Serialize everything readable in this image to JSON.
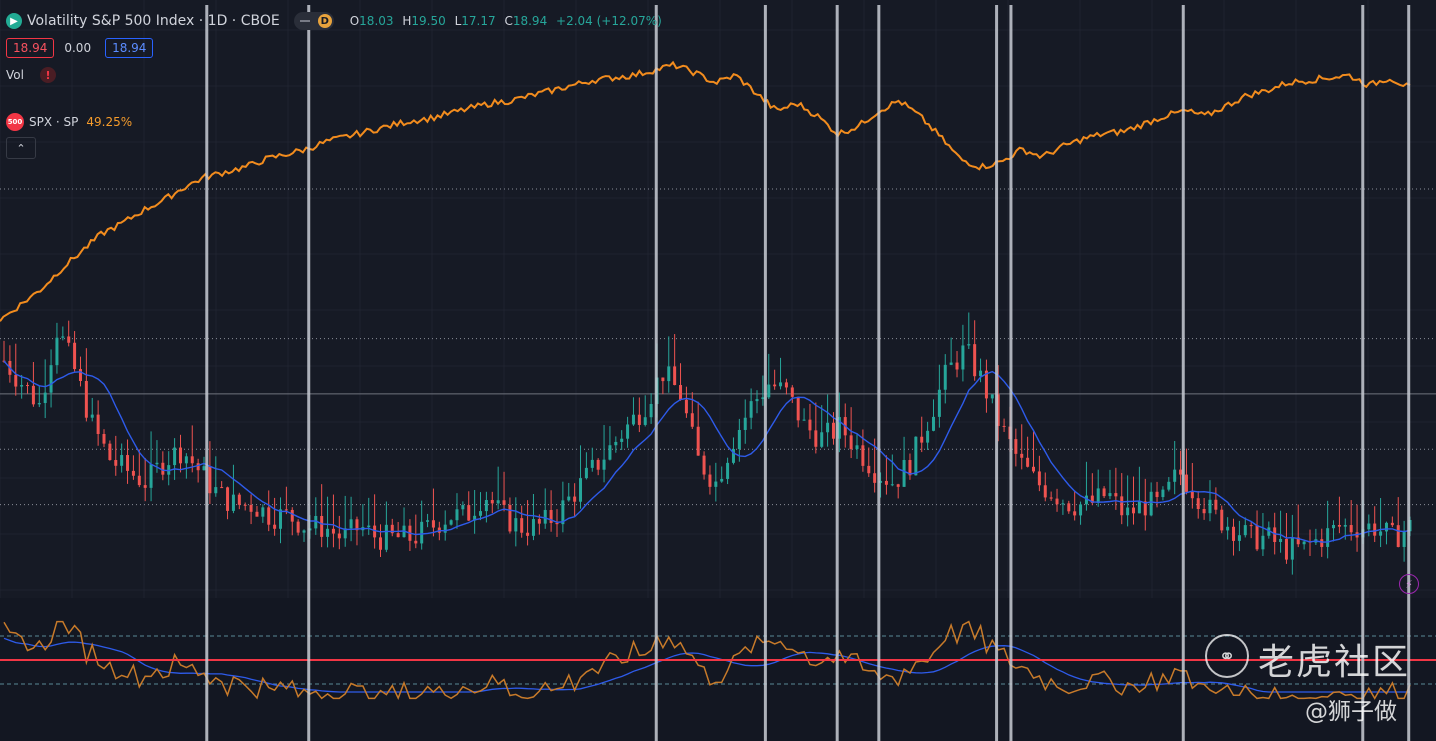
{
  "header": {
    "title": "Volatility S&P 500 Index · 1D · CBOE",
    "interval_badge": "D",
    "ohlc": [
      {
        "key": "O",
        "value": "18.03"
      },
      {
        "key": "H",
        "value": "19.50"
      },
      {
        "key": "L",
        "value": "17.17"
      },
      {
        "key": "C",
        "value": "18.94"
      }
    ],
    "change": "+2.04 (+12.07%)",
    "bid": "18.94",
    "spread": "0.00",
    "ask": "18.94",
    "vol_label": "Vol",
    "vol_warning": "!",
    "compare_label": "SPX · SP",
    "compare_icon_text": "500",
    "compare_pct": "49.25%"
  },
  "watermark": {
    "brand": "老虎社区",
    "author": "@狮子做"
  },
  "icons": [
    "arrow-right-icon",
    "warning-icon",
    "chevron-up-icon",
    "lightning-icon",
    "tiger-logo-icon"
  ],
  "colors": {
    "background": "#161a25",
    "spx_line": "#f28c1e",
    "ma_line": "#2e5bea",
    "up_candle": "#26a69a",
    "down_candle": "#ef5350",
    "osc_line": "#c77a2a",
    "osc_ref_line": "#f23645",
    "marker_line": "#c8ccd4"
  },
  "chart_data": {
    "type": "line",
    "note_series": [
      "SPX",
      "VIX",
      "VIX MA",
      "Oscillator"
    ],
    "vix_dashed_levels": [
      30,
      20,
      15
    ],
    "vix_solid_level": 25,
    "oscillator_reference_level": 0.5,
    "oscillator_band_levels": [
      0.8,
      0.2
    ],
    "marker_positions_fraction": [
      0.144,
      0.215,
      0.457,
      0.533,
      0.583,
      0.612,
      0.694,
      0.704,
      0.824,
      0.949,
      0.981
    ],
    "spx_normalized": [
      0.0,
      0.06,
      0.12,
      0.2,
      0.27,
      0.34,
      0.38,
      0.43,
      0.47,
      0.52,
      0.56,
      0.58,
      0.6,
      0.63,
      0.65,
      0.67,
      0.7,
      0.72,
      0.74,
      0.76,
      0.78,
      0.79,
      0.81,
      0.83,
      0.85,
      0.86,
      0.88,
      0.9,
      0.92,
      0.94,
      0.95,
      0.96,
      0.98,
      1.0,
      0.97,
      0.93,
      0.96,
      0.89,
      0.82,
      0.85,
      0.8,
      0.73,
      0.76,
      0.82,
      0.86,
      0.8,
      0.72,
      0.63,
      0.6,
      0.62,
      0.67,
      0.64,
      0.68,
      0.71,
      0.73,
      0.74,
      0.77,
      0.8,
      0.82,
      0.8,
      0.84,
      0.88,
      0.9,
      0.93,
      0.94,
      0.95,
      0.96,
      0.92,
      0.95,
      0.91
    ],
    "vix_close": [
      28,
      26,
      24,
      31,
      27,
      22,
      19,
      18,
      17,
      19,
      20,
      18,
      16,
      15,
      15,
      14,
      14,
      13,
      13,
      12,
      13,
      12,
      12,
      12,
      13,
      14,
      14,
      16,
      14,
      13,
      13,
      14,
      16,
      18,
      20,
      22,
      24,
      27,
      25,
      19,
      17,
      21,
      24,
      26,
      25,
      22,
      21,
      22,
      20,
      18,
      17,
      19,
      23,
      27,
      29,
      26,
      22,
      19,
      17,
      16,
      15,
      15,
      16,
      14,
      15,
      15,
      18,
      16,
      14,
      13,
      12,
      12,
      11,
      11,
      12,
      13,
      13,
      13,
      12,
      13
    ]
  }
}
